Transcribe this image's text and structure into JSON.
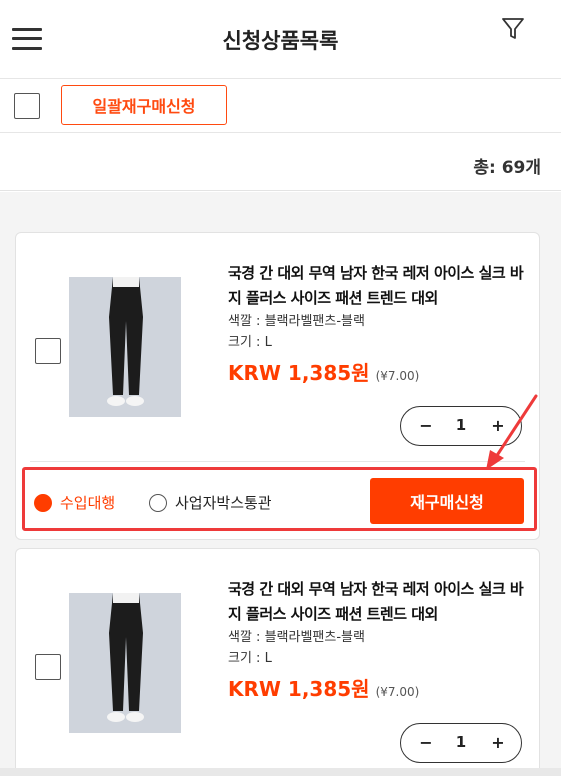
{
  "header": {
    "title": "신청상품목록"
  },
  "toolbar": {
    "bulk_reorder_label": "일괄재구매신청"
  },
  "summary": {
    "total_label": "총:",
    "total_count": "69개"
  },
  "items": [
    {
      "name": "국경 간 대외 무역 남자 한국 레저 아이스 실크 바지 플러스 사이즈 패션 트렌드 대외",
      "color": "색깔 : 블랙라벨팬츠-블랙",
      "size": "크기 : L",
      "price": "KRW 1,385원",
      "sub_price": "(¥7.00)",
      "quantity": "1"
    },
    {
      "name": "국경 간 대외 무역 남자 한국 레저 아이스 실크 바지 플러스 사이즈 패션 트렌드 대외",
      "color": "색깔 : 블랙라벨팬츠-블랙",
      "size": "크기 : L",
      "price": "KRW 1,385원",
      "sub_price": "(¥7.00)",
      "quantity": "1"
    }
  ],
  "actions": {
    "radio_import": "수입대행",
    "radio_business": "사업자박스통관",
    "reorder_label": "재구매신청",
    "minus": "−",
    "plus": "+"
  },
  "colors": {
    "accent": "#ff3d00",
    "annotation": "#ee3a3a"
  }
}
